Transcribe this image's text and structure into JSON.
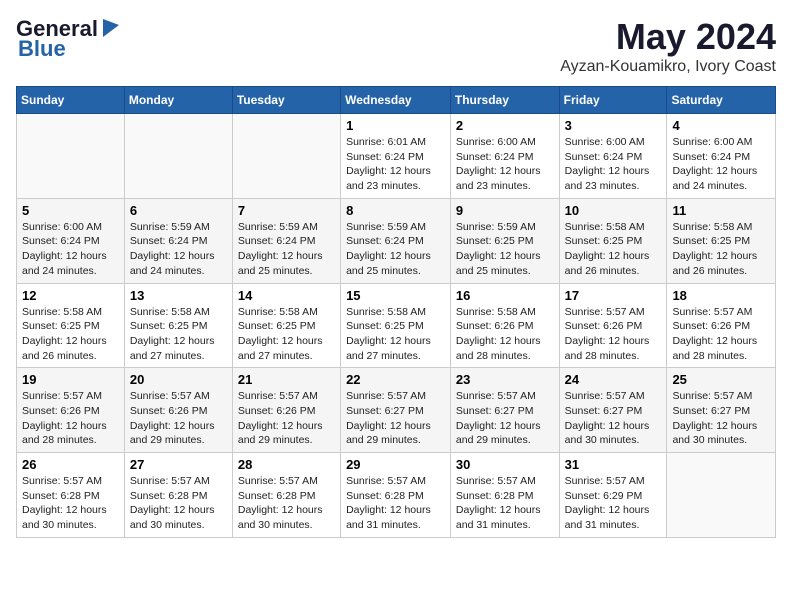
{
  "logo": {
    "line1": "General",
    "line2": "Blue"
  },
  "title": "May 2024",
  "subtitle": "Ayzan-Kouamikro, Ivory Coast",
  "days_header": [
    "Sunday",
    "Monday",
    "Tuesday",
    "Wednesday",
    "Thursday",
    "Friday",
    "Saturday"
  ],
  "weeks": [
    [
      {
        "day": "",
        "info": ""
      },
      {
        "day": "",
        "info": ""
      },
      {
        "day": "",
        "info": ""
      },
      {
        "day": "1",
        "info": "Sunrise: 6:01 AM\nSunset: 6:24 PM\nDaylight: 12 hours\nand 23 minutes."
      },
      {
        "day": "2",
        "info": "Sunrise: 6:00 AM\nSunset: 6:24 PM\nDaylight: 12 hours\nand 23 minutes."
      },
      {
        "day": "3",
        "info": "Sunrise: 6:00 AM\nSunset: 6:24 PM\nDaylight: 12 hours\nand 23 minutes."
      },
      {
        "day": "4",
        "info": "Sunrise: 6:00 AM\nSunset: 6:24 PM\nDaylight: 12 hours\nand 24 minutes."
      }
    ],
    [
      {
        "day": "5",
        "info": "Sunrise: 6:00 AM\nSunset: 6:24 PM\nDaylight: 12 hours\nand 24 minutes."
      },
      {
        "day": "6",
        "info": "Sunrise: 5:59 AM\nSunset: 6:24 PM\nDaylight: 12 hours\nand 24 minutes."
      },
      {
        "day": "7",
        "info": "Sunrise: 5:59 AM\nSunset: 6:24 PM\nDaylight: 12 hours\nand 25 minutes."
      },
      {
        "day": "8",
        "info": "Sunrise: 5:59 AM\nSunset: 6:24 PM\nDaylight: 12 hours\nand 25 minutes."
      },
      {
        "day": "9",
        "info": "Sunrise: 5:59 AM\nSunset: 6:25 PM\nDaylight: 12 hours\nand 25 minutes."
      },
      {
        "day": "10",
        "info": "Sunrise: 5:58 AM\nSunset: 6:25 PM\nDaylight: 12 hours\nand 26 minutes."
      },
      {
        "day": "11",
        "info": "Sunrise: 5:58 AM\nSunset: 6:25 PM\nDaylight: 12 hours\nand 26 minutes."
      }
    ],
    [
      {
        "day": "12",
        "info": "Sunrise: 5:58 AM\nSunset: 6:25 PM\nDaylight: 12 hours\nand 26 minutes."
      },
      {
        "day": "13",
        "info": "Sunrise: 5:58 AM\nSunset: 6:25 PM\nDaylight: 12 hours\nand 27 minutes."
      },
      {
        "day": "14",
        "info": "Sunrise: 5:58 AM\nSunset: 6:25 PM\nDaylight: 12 hours\nand 27 minutes."
      },
      {
        "day": "15",
        "info": "Sunrise: 5:58 AM\nSunset: 6:25 PM\nDaylight: 12 hours\nand 27 minutes."
      },
      {
        "day": "16",
        "info": "Sunrise: 5:58 AM\nSunset: 6:26 PM\nDaylight: 12 hours\nand 28 minutes."
      },
      {
        "day": "17",
        "info": "Sunrise: 5:57 AM\nSunset: 6:26 PM\nDaylight: 12 hours\nand 28 minutes."
      },
      {
        "day": "18",
        "info": "Sunrise: 5:57 AM\nSunset: 6:26 PM\nDaylight: 12 hours\nand 28 minutes."
      }
    ],
    [
      {
        "day": "19",
        "info": "Sunrise: 5:57 AM\nSunset: 6:26 PM\nDaylight: 12 hours\nand 28 minutes."
      },
      {
        "day": "20",
        "info": "Sunrise: 5:57 AM\nSunset: 6:26 PM\nDaylight: 12 hours\nand 29 minutes."
      },
      {
        "day": "21",
        "info": "Sunrise: 5:57 AM\nSunset: 6:26 PM\nDaylight: 12 hours\nand 29 minutes."
      },
      {
        "day": "22",
        "info": "Sunrise: 5:57 AM\nSunset: 6:27 PM\nDaylight: 12 hours\nand 29 minutes."
      },
      {
        "day": "23",
        "info": "Sunrise: 5:57 AM\nSunset: 6:27 PM\nDaylight: 12 hours\nand 29 minutes."
      },
      {
        "day": "24",
        "info": "Sunrise: 5:57 AM\nSunset: 6:27 PM\nDaylight: 12 hours\nand 30 minutes."
      },
      {
        "day": "25",
        "info": "Sunrise: 5:57 AM\nSunset: 6:27 PM\nDaylight: 12 hours\nand 30 minutes."
      }
    ],
    [
      {
        "day": "26",
        "info": "Sunrise: 5:57 AM\nSunset: 6:28 PM\nDaylight: 12 hours\nand 30 minutes."
      },
      {
        "day": "27",
        "info": "Sunrise: 5:57 AM\nSunset: 6:28 PM\nDaylight: 12 hours\nand 30 minutes."
      },
      {
        "day": "28",
        "info": "Sunrise: 5:57 AM\nSunset: 6:28 PM\nDaylight: 12 hours\nand 30 minutes."
      },
      {
        "day": "29",
        "info": "Sunrise: 5:57 AM\nSunset: 6:28 PM\nDaylight: 12 hours\nand 31 minutes."
      },
      {
        "day": "30",
        "info": "Sunrise: 5:57 AM\nSunset: 6:28 PM\nDaylight: 12 hours\nand 31 minutes."
      },
      {
        "day": "31",
        "info": "Sunrise: 5:57 AM\nSunset: 6:29 PM\nDaylight: 12 hours\nand 31 minutes."
      },
      {
        "day": "",
        "info": ""
      }
    ]
  ]
}
